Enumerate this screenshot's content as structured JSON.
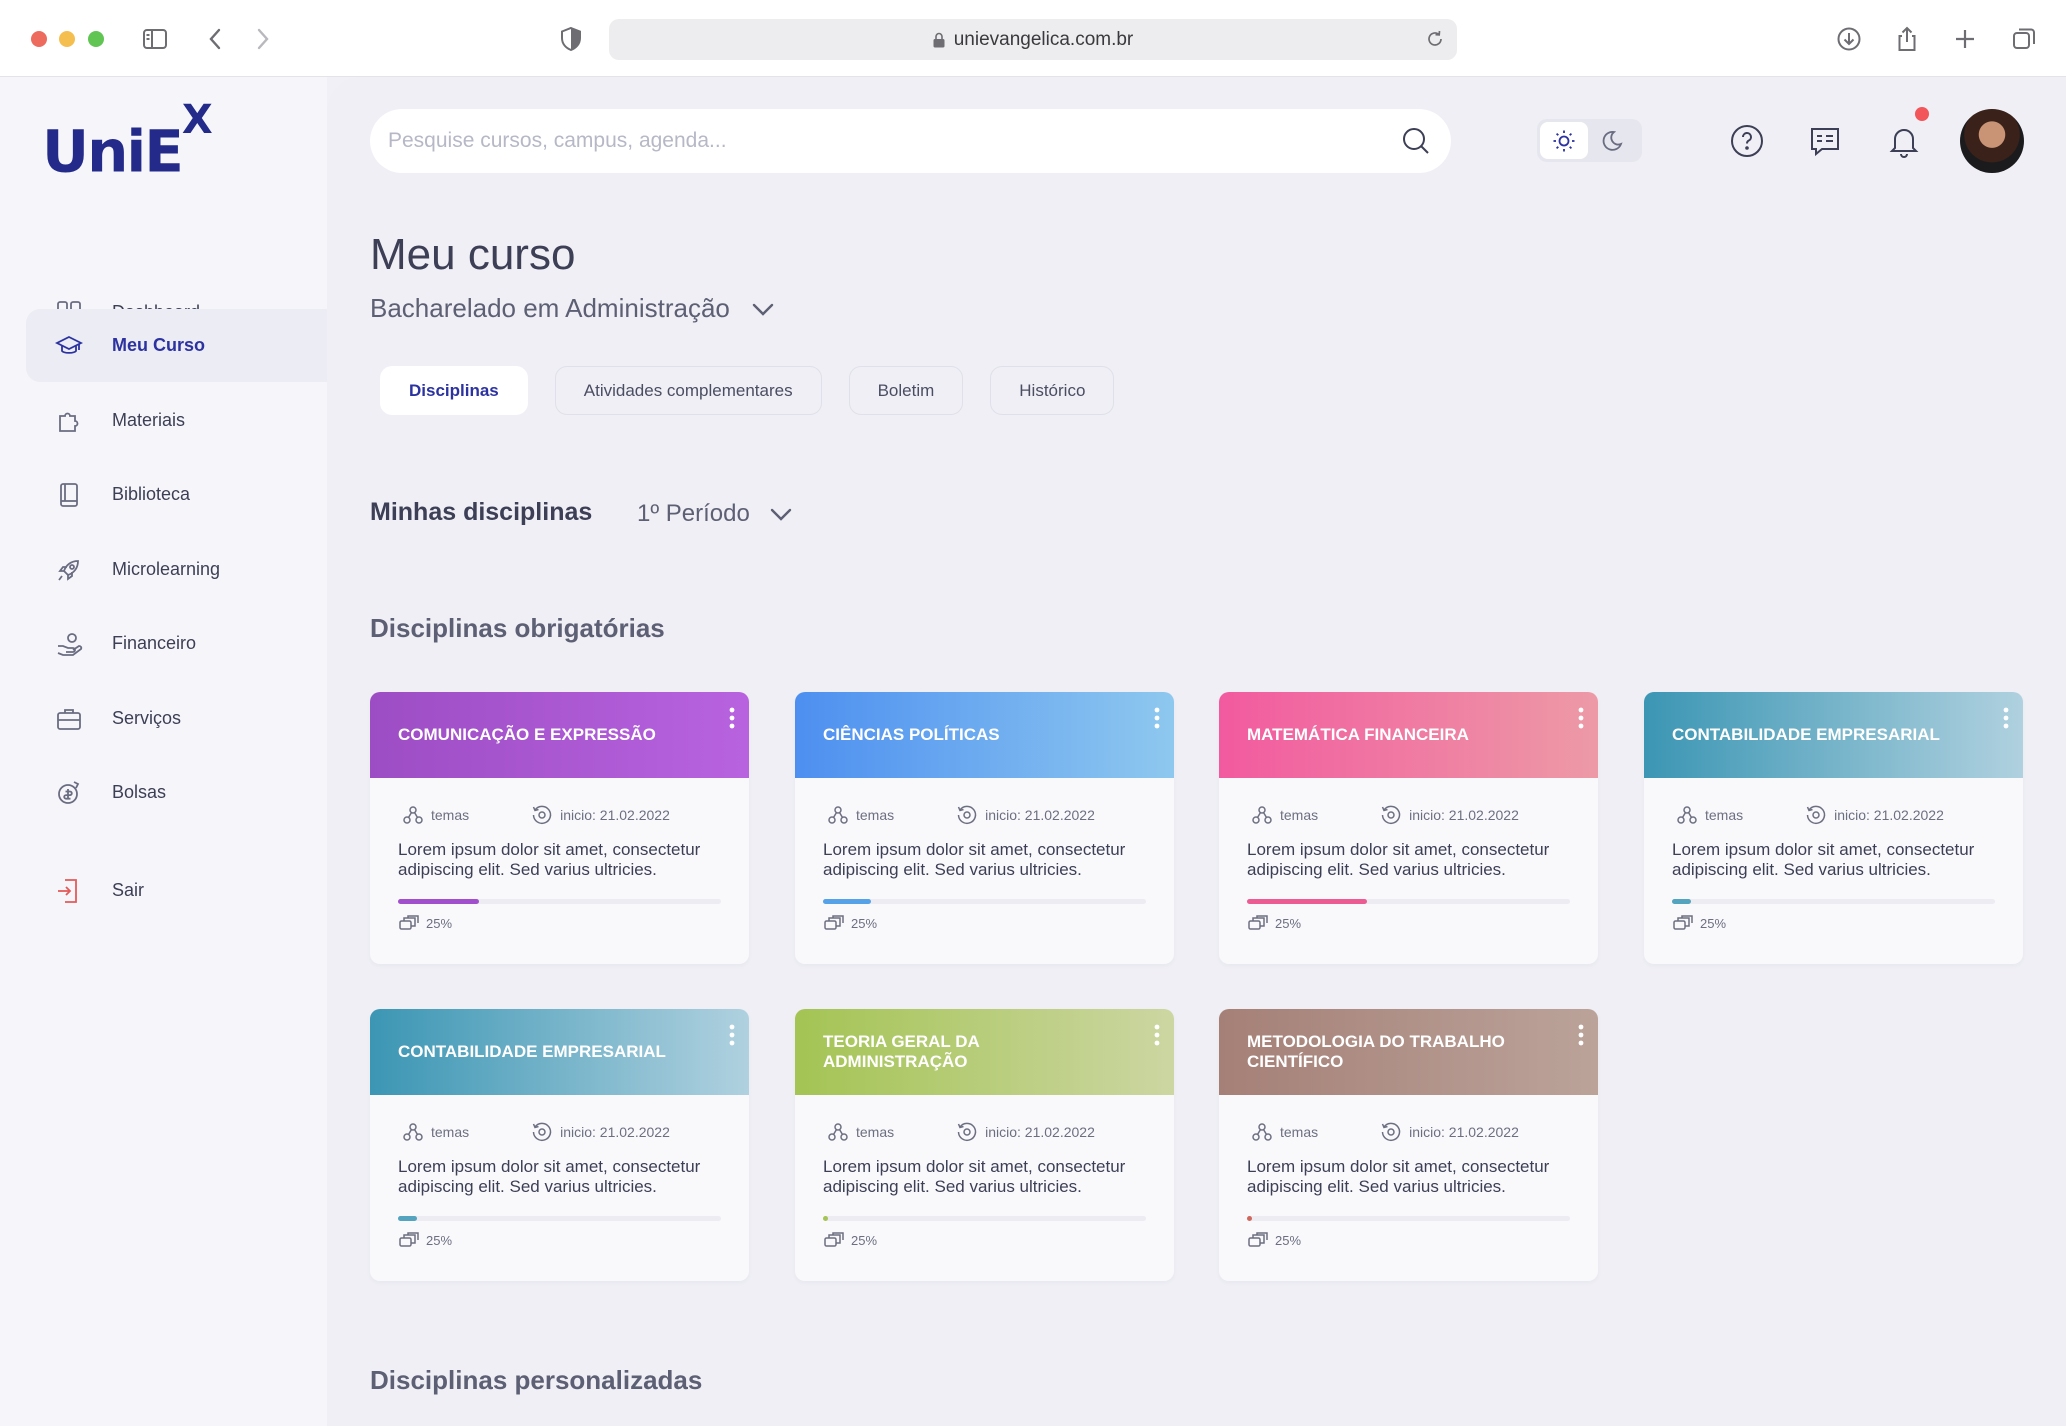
{
  "browser": {
    "url": "unievangelica.com.br"
  },
  "logo": {
    "text": "UniE",
    "sup": "X"
  },
  "sidebar": {
    "items": [
      {
        "label": "Dashboard",
        "icon": "grid-icon",
        "active": false
      },
      {
        "label": "Meu Curso",
        "icon": "graduation-cap-icon",
        "active": true
      },
      {
        "label": "Materiais",
        "icon": "puzzle-icon",
        "active": false
      },
      {
        "label": "Biblioteca",
        "icon": "book-icon",
        "active": false
      },
      {
        "label": "Microlearning",
        "icon": "rocket-icon",
        "active": false
      },
      {
        "label": "Financeiro",
        "icon": "hand-coin-icon",
        "active": false
      },
      {
        "label": "Serviços",
        "icon": "briefcase-icon",
        "active": false
      },
      {
        "label": "Bolsas",
        "icon": "coin-refresh-icon",
        "active": false
      }
    ],
    "logout": "Sair"
  },
  "search": {
    "placeholder": "Pesquise cursos, campus, agenda..."
  },
  "theme": {
    "selected": "light"
  },
  "page": {
    "title": "Meu curso",
    "course": "Bacharelado em Administração",
    "tabs": [
      "Disciplinas",
      "Atividades complementares",
      "Boletim",
      "Histórico"
    ],
    "active_tab": "Disciplinas",
    "my_disciplines": "Minhas disciplinas",
    "period": "1º Período",
    "required_heading": "Disciplinas obrigatórias",
    "custom_heading": "Disciplinas personalizadas"
  },
  "colors": {
    "accent": "#2c33a0",
    "notification": "#f2555a"
  },
  "cards": [
    {
      "title": "COMUNICAÇÃO E EXPRESSÃO",
      "topics": "temas",
      "start": "inicio: 21.02.2022",
      "desc": "Lorem ipsum dolor sit amet, consectetur adipiscing elit. Sed varius ultricies.",
      "progress_label": "25%",
      "progress": 0.25,
      "gradient": [
        "#9d4dc4",
        "#b862e0"
      ],
      "bar": "#a24fcd"
    },
    {
      "title": "CIÊNCIAS POLÍTICAS",
      "topics": "temas",
      "start": "inicio: 21.02.2022",
      "desc": "Lorem ipsum dolor sit amet, consectetur adipiscing elit. Sed varius ultricies.",
      "progress_label": "25%",
      "progress": 0.15,
      "gradient": [
        "#4d8ff0",
        "#8ec8ef"
      ],
      "bar": "#55a2e8"
    },
    {
      "title": "MATEMÁTICA FINANCEIRA",
      "topics": "temas",
      "start": "inicio: 21.02.2022",
      "desc": "Lorem ipsum dolor sit amet, consectetur adipiscing elit. Sed varius ultricies.",
      "progress_label": "25%",
      "progress": 0.37,
      "gradient": [
        "#f25a9f",
        "#ed9aa6"
      ],
      "bar": "#ec5c92"
    },
    {
      "title": "CONTABILIDADE EMPRESARIAL",
      "topics": "temas",
      "start": "inicio: 21.02.2022",
      "desc": "Lorem ipsum dolor sit amet, consectetur adipiscing elit. Sed varius ultricies.",
      "progress_label": "25%",
      "progress": 0.06,
      "gradient": [
        "#3b96b4",
        "#b0d1df"
      ],
      "bar": "#54a3bf"
    },
    {
      "title": "CONTABILIDADE EMPRESARIAL",
      "topics": "temas",
      "start": "inicio: 21.02.2022",
      "desc": "Lorem ipsum dolor sit amet, consectetur adipiscing elit. Sed varius ultricies.",
      "progress_label": "25%",
      "progress": 0.06,
      "gradient": [
        "#3b96b4",
        "#b0d1df"
      ],
      "bar": "#54a3bf"
    },
    {
      "title": "TEORIA GERAL DA ADMINISTRAÇÃO",
      "topics": "temas",
      "start": "inicio: 21.02.2022",
      "desc": "Lorem ipsum dolor sit amet, consectetur adipiscing elit. Sed varius ultricies.",
      "progress_label": "25%",
      "progress": 0.01,
      "gradient": [
        "#a4c454",
        "#ccd6a2"
      ],
      "bar": "#a4c454"
    },
    {
      "title": "METODOLOGIA DO TRABALHO CIENTÍFICO",
      "topics": "temas",
      "start": "inicio: 21.02.2022",
      "desc": "Lorem ipsum dolor sit amet, consectetur adipiscing elit. Sed varius ultricies.",
      "progress_label": "25%",
      "progress": 0.01,
      "gradient": [
        "#a58077",
        "#bba39a"
      ],
      "bar": "#d0675d"
    }
  ]
}
